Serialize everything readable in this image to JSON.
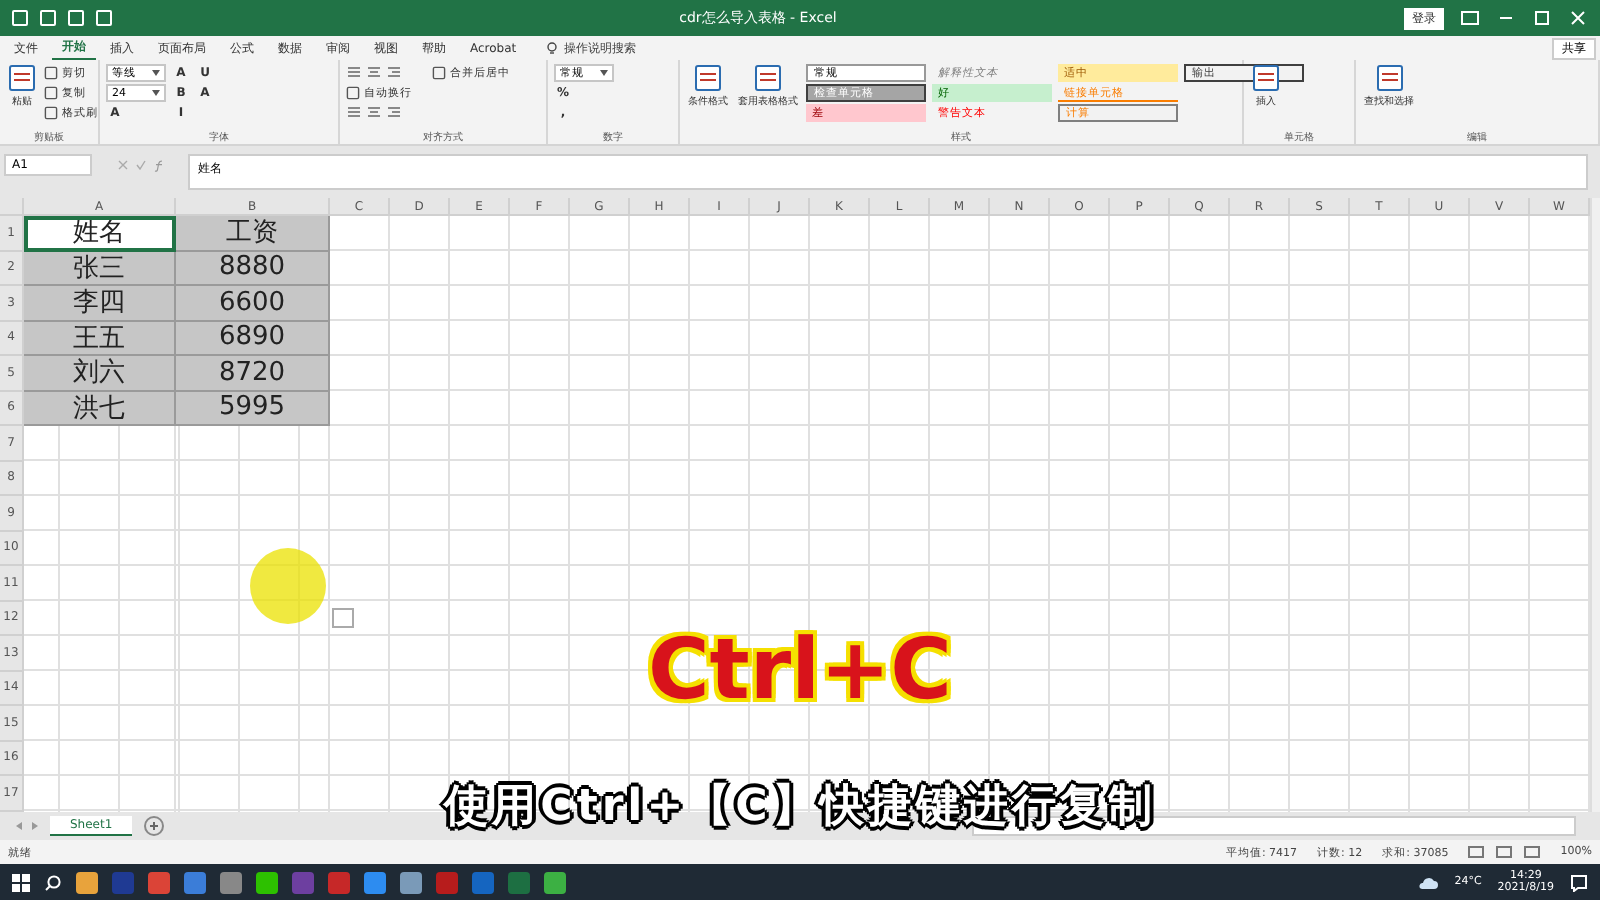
{
  "window": {
    "title": "cdr怎么导入表格 - Excel",
    "login_button": "登录"
  },
  "menu_tabs": [
    {
      "label": "文件",
      "selected": false
    },
    {
      "label": "开始",
      "selected": true
    },
    {
      "label": "插入",
      "selected": false
    },
    {
      "label": "页面布局",
      "selected": false
    },
    {
      "label": "公式",
      "selected": false
    },
    {
      "label": "数据",
      "selected": false
    },
    {
      "label": "审阅",
      "selected": false
    },
    {
      "label": "视图",
      "selected": false
    },
    {
      "label": "帮助",
      "selected": false
    },
    {
      "label": "Acrobat",
      "selected": false
    }
  ],
  "tell_me": "操作说明搜索",
  "share_button": "共享",
  "ribbon_groups": [
    {
      "label": "剪贴板",
      "items": [
        {
          "kind": "large",
          "label": "粘贴"
        },
        {
          "kind": "small",
          "label": "剪切"
        },
        {
          "kind": "small",
          "label": "复制"
        },
        {
          "kind": "small",
          "label": "格式刷"
        }
      ]
    },
    {
      "label": "字体",
      "items": [
        {
          "kind": "dropdown",
          "label": "等线"
        },
        {
          "kind": "dropdown",
          "label": "24"
        },
        {
          "kind": "letter",
          "label": "A"
        },
        {
          "kind": "letter",
          "label": "A"
        },
        {
          "kind": "letter",
          "label": "B"
        },
        {
          "kind": "letter",
          "label": "I"
        },
        {
          "kind": "letter",
          "label": "U"
        },
        {
          "kind": "letter",
          "label": "A"
        }
      ]
    },
    {
      "label": "对齐方式",
      "items": [
        {
          "kind": "iconrow"
        },
        {
          "kind": "small",
          "label": "自动换行"
        },
        {
          "kind": "iconrow"
        },
        {
          "kind": "small",
          "label": "合并后居中"
        }
      ]
    },
    {
      "label": "数字",
      "items": [
        {
          "kind": "dropdown",
          "label": "常规"
        },
        {
          "kind": "letter",
          "label": "%"
        },
        {
          "kind": "letter",
          "label": ","
        }
      ]
    },
    {
      "label": "样式",
      "items": [
        {
          "kind": "large",
          "label": "条件格式"
        },
        {
          "kind": "large",
          "label": "套用表格格式"
        },
        {
          "kind": "normal",
          "label": "常规"
        },
        {
          "kind": "check",
          "label": "检查单元格"
        },
        {
          "kind": "bad",
          "label": "差"
        },
        {
          "kind": "explanatory",
          "label": "解释性文本"
        },
        {
          "kind": "good",
          "label": "好"
        },
        {
          "kind": "warning",
          "label": "警告文本"
        },
        {
          "kind": "neutral",
          "label": "适中"
        },
        {
          "kind": "linked",
          "label": "链接单元格"
        },
        {
          "kind": "calc",
          "label": "计算"
        },
        {
          "kind": "output",
          "label": "输出"
        }
      ]
    },
    {
      "label": "单元格",
      "items": [
        {
          "kind": "large",
          "label": "插入"
        }
      ]
    },
    {
      "label": "编辑",
      "items": [
        {
          "kind": "large",
          "label": "查找和选择"
        }
      ]
    }
  ],
  "formula_bar": {
    "name_box": "A1",
    "value": "姓名"
  },
  "sheet": {
    "columns": [
      "A",
      "B",
      "C",
      "D",
      "E",
      "F",
      "G",
      "H",
      "I",
      "J",
      "K",
      "L",
      "M",
      "N",
      "O",
      "P",
      "Q",
      "R",
      "S",
      "T",
      "U",
      "V",
      "W"
    ],
    "rows": [
      {
        "number": "1",
        "cells": [
          {
            "text": "姓名",
            "selected": true,
            "active": true
          },
          {
            "text": "工资",
            "selected": true,
            "active": false
          }
        ]
      },
      {
        "number": "2",
        "cells": [
          {
            "text": "张三",
            "selected": true,
            "active": false
          },
          {
            "text": "8880",
            "selected": true,
            "active": false
          }
        ]
      },
      {
        "number": "3",
        "cells": [
          {
            "text": "李四",
            "selected": true,
            "active": false
          },
          {
            "text": "6600",
            "selected": true,
            "active": false
          }
        ]
      },
      {
        "number": "4",
        "cells": [
          {
            "text": "王五",
            "selected": true,
            "active": false
          },
          {
            "text": "6890",
            "selected": true,
            "active": false
          }
        ]
      },
      {
        "number": "5",
        "cells": [
          {
            "text": "刘六",
            "selected": true,
            "active": false
          },
          {
            "text": "8720",
            "selected": true,
            "active": false
          }
        ]
      },
      {
        "number": "6",
        "cells": [
          {
            "text": "洪七",
            "selected": true,
            "active": false
          },
          {
            "text": "5995",
            "selected": true,
            "active": false
          }
        ]
      },
      {
        "number": "7"
      },
      {
        "number": "8"
      },
      {
        "number": "9"
      },
      {
        "number": "10"
      },
      {
        "number": "11"
      },
      {
        "number": "12"
      },
      {
        "number": "13"
      },
      {
        "number": "14"
      },
      {
        "number": "15"
      },
      {
        "number": "16"
      },
      {
        "number": "17"
      }
    ]
  },
  "sheet_tabs": [
    {
      "label": "Sheet1",
      "selected": true
    }
  ],
  "status_bar": {
    "mode": "就绪",
    "average": "平均值: 7417",
    "count": "计数: 12",
    "sum": "求和: 37085",
    "zoom": "100%"
  },
  "overlay": {
    "key_caption": "Ctrl+C",
    "subtitle": "使用Ctrl+【C】快捷键进行复制"
  },
  "taskbar": {
    "apps": [
      {
        "color": "#e8a33c"
      },
      {
        "color": "#1f3a93"
      },
      {
        "color": "#db4437"
      },
      {
        "color": "#3b7dd8"
      },
      {
        "color": "#888888"
      },
      {
        "color": "#2dc100"
      },
      {
        "color": "#6d3fa0"
      },
      {
        "color": "#c62828"
      },
      {
        "color": "#2d8cf0"
      },
      {
        "color": "#7a9ab8"
      },
      {
        "color": "#b71c1c"
      },
      {
        "color": "#1565c0"
      },
      {
        "color": "#1d6f42"
      },
      {
        "color": "#3cb043"
      }
    ],
    "weather": "24°C",
    "time": "14:29",
    "date": "2021/8/19"
  }
}
